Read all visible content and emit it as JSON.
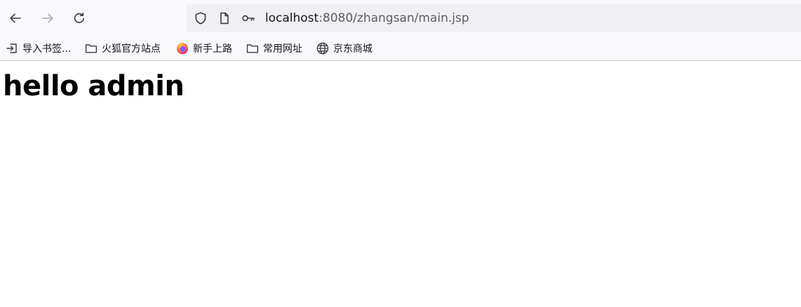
{
  "toolbar": {
    "back_icon": "arrow-left-icon",
    "forward_icon": "arrow-right-icon",
    "reload_icon": "reload-icon"
  },
  "urlbar": {
    "shield_icon": "shield-icon",
    "page_icon": "page-icon",
    "key_icon": "key-icon",
    "host": "localhost",
    "rest": ":8080/zhangsan/main.jsp"
  },
  "bookmarks": [
    {
      "label": "导入书签...",
      "icon": "import-icon"
    },
    {
      "label": "火狐官方站点",
      "icon": "folder-icon"
    },
    {
      "label": "新手上路",
      "icon": "firefox-icon"
    },
    {
      "label": "常用网址",
      "icon": "folder-icon"
    },
    {
      "label": "京东商城",
      "icon": "globe-icon"
    }
  ],
  "page": {
    "heading": "hello admin"
  },
  "colors": {
    "toolbar_bg": "#f9f9fb",
    "urlbar_bg": "#f0f0f4",
    "firefox_orange": "#ff7139",
    "firefox_purple": "#9059ff"
  }
}
